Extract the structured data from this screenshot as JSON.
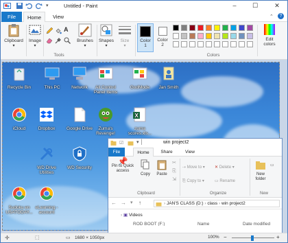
{
  "title": "Untitled - Paint",
  "tabs": {
    "file": "File",
    "home": "Home",
    "view": "View"
  },
  "ribbon": {
    "clipboard": "Clipboard",
    "image": "Image",
    "tools_label": "Tools",
    "brushes": "Brushes",
    "shapes": "Shapes",
    "size": "Size",
    "color1": "Color\n1",
    "color2": "Color\n2",
    "colors_label": "Colors",
    "edit_colors": "Edit\ncolors"
  },
  "palette": {
    "row1": [
      "#000000",
      "#7f7f7f",
      "#880015",
      "#ed1c24",
      "#ff7f27",
      "#fff200",
      "#22b14c",
      "#00a2e8",
      "#3f48cc",
      "#a349a4"
    ],
    "row2": [
      "#ffffff",
      "#c3c3c3",
      "#b97a57",
      "#ffaec9",
      "#ffc90e",
      "#efe4b0",
      "#b5e61d",
      "#99d9ea",
      "#7092be",
      "#c8bfe7"
    ],
    "row3": [
      "#ffffff",
      "#ffffff",
      "#ffffff",
      "#ffffff",
      "#ffffff",
      "#ffffff",
      "#ffffff",
      "#ffffff",
      "#ffffff",
      "#ffffff"
    ]
  },
  "desktop_icons": [
    {
      "name": "recycle-bin",
      "label": "Recycle Bin"
    },
    {
      "name": "this-pc",
      "label": "This PC"
    },
    {
      "name": "network",
      "label": "Network"
    },
    {
      "name": "all-control-panel-items",
      "label": "All Control Panel Items"
    },
    {
      "name": "godmode",
      "label": "GodMode"
    },
    {
      "name": "jan-smith",
      "label": "Jan Smith"
    },
    {
      "name": "icloud",
      "label": "iCloud"
    },
    {
      "name": "dropbox",
      "label": "Dropbox"
    },
    {
      "name": "google-drive",
      "label": "Google Drive"
    },
    {
      "name": "zumas-revenge",
      "label": "Zuma's Revenge!"
    },
    {
      "name": "zuma-scores",
      "label": "zuma scores.xls..."
    },
    {
      "name": "wd-drive-utilities",
      "label": "WD Drive Utilities"
    },
    {
      "name": "wd-security",
      "label": "WD Security"
    },
    {
      "name": "sudoku",
      "label": "Sudoku en USATODAY..."
    },
    {
      "name": "elearning",
      "label": "eLearning - account"
    }
  ],
  "explorer": {
    "title": "win project2",
    "tabs": {
      "file": "File",
      "home": "Home",
      "share": "Share",
      "view": "View"
    },
    "pin": "Pin to Quick access",
    "copy": "Copy",
    "paste": "Paste",
    "clipboard_label": "Clipboard",
    "move_to": "Move to",
    "copy_to": "Copy to",
    "delete": "Delete",
    "rename": "Rename",
    "organize_label": "Organize",
    "new_folder": "New folder",
    "new_label": "New",
    "breadcrumb": [
      "JAN'S CLASS (D:)",
      "class",
      "win project2"
    ],
    "tree_item": "Videos",
    "tree_item2": "ROD BOOT (F:)",
    "col_name": "Name",
    "col_date": "Date modified"
  },
  "status": {
    "dimensions": "1680 × 1050px",
    "zoom": "100%"
  }
}
